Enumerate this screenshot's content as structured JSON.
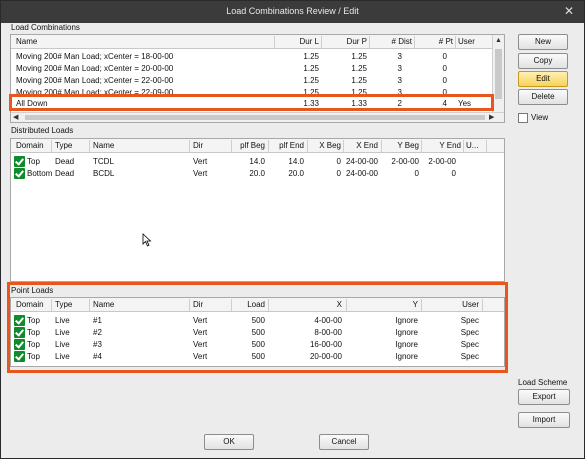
{
  "window": {
    "title": "Load Combinations Review / Edit"
  },
  "load_combinations": {
    "label": "Load Combinations",
    "columns": [
      "Name",
      "Dur L",
      "Dur P",
      "# Dist",
      "# Pt",
      "User"
    ],
    "rows": [
      {
        "name": "Moving 200# Man Load; xCenter = 18-00-00",
        "dur_l": "1.25",
        "dur_p": "1.25",
        "dist": "3",
        "pt": "0",
        "user": ""
      },
      {
        "name": "Moving 200# Man Load; xCenter = 20-00-00",
        "dur_l": "1.25",
        "dur_p": "1.25",
        "dist": "3",
        "pt": "0",
        "user": ""
      },
      {
        "name": "Moving 200# Man Load; xCenter = 22-00-00",
        "dur_l": "1.25",
        "dur_p": "1.25",
        "dist": "3",
        "pt": "0",
        "user": ""
      },
      {
        "name": "Moving 200# Man Load; xCenter = 22-09-00",
        "dur_l": "1.25",
        "dur_p": "1.25",
        "dist": "3",
        "pt": "0",
        "user": ""
      },
      {
        "name": "All Down",
        "dur_l": "1.33",
        "dur_p": "1.33",
        "dist": "2",
        "pt": "4",
        "user": "Yes"
      }
    ]
  },
  "distributed_loads": {
    "label": "Distributed Loads",
    "columns": [
      "Domain",
      "Type",
      "Name",
      "Dir",
      "plf Beg",
      "plf End",
      "X Beg",
      "X End",
      "Y Beg",
      "Y End",
      "U..."
    ],
    "rows": [
      {
        "domain": "Top",
        "type": "Dead",
        "name": "TCDL",
        "dir": "Vert",
        "plf_beg": "14.0",
        "plf_end": "14.0",
        "x_beg": "0",
        "x_end": "24-00-00",
        "y_beg": "2-00-00",
        "y_end": "2-00-00",
        "u": ""
      },
      {
        "domain": "Bottom",
        "type": "Dead",
        "name": "BCDL",
        "dir": "Vert",
        "plf_beg": "20.0",
        "plf_end": "20.0",
        "x_beg": "0",
        "x_end": "24-00-00",
        "y_beg": "0",
        "y_end": "0",
        "u": ""
      }
    ]
  },
  "point_loads": {
    "label": "Point Loads",
    "columns": [
      "Domain",
      "Type",
      "Name",
      "Dir",
      "Load",
      "X",
      "Y",
      "User"
    ],
    "rows": [
      {
        "domain": "Top",
        "type": "Live",
        "name": "#1",
        "dir": "Vert",
        "load": "500",
        "x": "4-00-00",
        "y": "Ignore",
        "user": "Spec"
      },
      {
        "domain": "Top",
        "type": "Live",
        "name": "#2",
        "dir": "Vert",
        "load": "500",
        "x": "8-00-00",
        "y": "Ignore",
        "user": "Spec"
      },
      {
        "domain": "Top",
        "type": "Live",
        "name": "#3",
        "dir": "Vert",
        "load": "500",
        "x": "16-00-00",
        "y": "Ignore",
        "user": "Spec"
      },
      {
        "domain": "Top",
        "type": "Live",
        "name": "#4",
        "dir": "Vert",
        "load": "500",
        "x": "20-00-00",
        "y": "Ignore",
        "user": "Spec"
      }
    ]
  },
  "buttons": {
    "new": "New",
    "copy": "Copy",
    "edit": "Edit",
    "delete": "Delete",
    "view": "View",
    "load_scheme": "Load Scheme",
    "export": "Export",
    "import": "Import",
    "ok": "OK",
    "cancel": "Cancel"
  },
  "colors": {
    "highlight": "#e8561d",
    "edit_button": "#f6d35a",
    "check": "#0e8b2a",
    "titlebar": "#3b3b3b"
  }
}
